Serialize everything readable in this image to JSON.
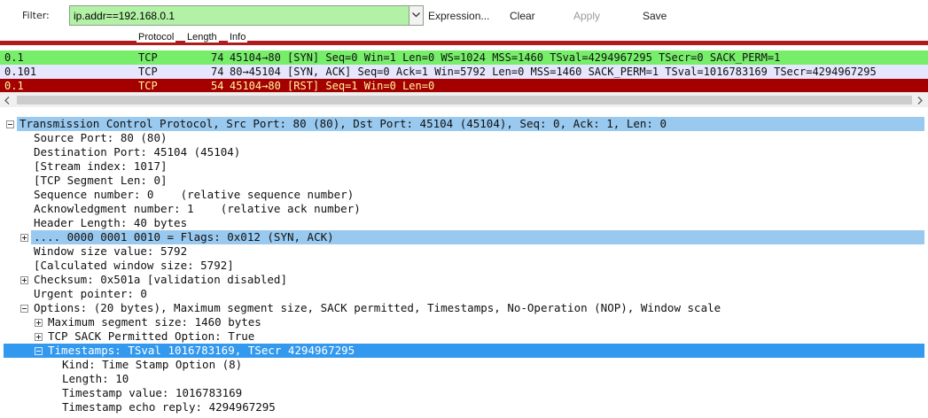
{
  "toolbar": {
    "filter_label": "Filter:",
    "filter_value": "ip.addr==192.168.0.1",
    "expression_label": "Expression...",
    "clear_label": "Clear",
    "apply_label": "Apply",
    "save_label": "Save"
  },
  "packet_list": {
    "columns": [
      "Protocol",
      "Length",
      "Info"
    ],
    "rows": [
      {
        "source": "0.1",
        "protocol": "TCP",
        "length": "74",
        "info": "45104→80 [SYN] Seq=0 Win=1 Len=0 WS=1024 MSS=1460 TSval=4294967295 TSecr=0 SACK_PERM=1",
        "bg": "#76ee6a",
        "fg": "#101010"
      },
      {
        "source": "0.101",
        "protocol": "TCP",
        "length": "74",
        "info": "80→45104 [SYN, ACK] Seq=0 Ack=1 Win=5792 Len=0 MSS=1460 SACK_PERM=1 TSval=1016783169 TSecr=4294967295",
        "bg": "#e7e6ff",
        "fg": "#101010"
      },
      {
        "source": "0.1",
        "protocol": "TCP",
        "length": "54",
        "info": "45104→80 [RST] Seq=1 Win=0 Len=0",
        "bg": "#a40000",
        "fg": "#fff7a0"
      }
    ]
  },
  "details": {
    "tcp_header": "Transmission Control Protocol, Src Port: 80 (80), Dst Port: 45104 (45104), Seq: 0, Ack: 1, Len: 0",
    "source_port": "Source Port: 80 (80)",
    "destination_port": "Destination Port: 45104 (45104)",
    "stream_index": "[Stream index: 1017]",
    "segment_len": "[TCP Segment Len: 0]",
    "sequence_number": "Sequence number: 0    (relative sequence number)",
    "ack_number": "Acknowledgment number: 1    (relative ack number)",
    "header_length": "Header Length: 40 bytes",
    "flags": ".... 0000 0001 0010 = Flags: 0x012 (SYN, ACK)",
    "window_size": "Window size value: 5792",
    "calc_window": "[Calculated window size: 5792]",
    "checksum": "Checksum: 0x501a [validation disabled]",
    "urgent_pointer": "Urgent pointer: 0",
    "options": "Options: (20 bytes), Maximum segment size, SACK permitted, Timestamps, No-Operation (NOP), Window scale",
    "mss": "Maximum segment size: 1460 bytes",
    "sack_permitted": "TCP SACK Permitted Option: True",
    "timestamps": "Timestamps: TSval 1016783169, TSecr 4294967295",
    "ts_kind": "Kind: Time Stamp Option (8)",
    "ts_length": "Length: 10",
    "ts_value": "Timestamp value: 1016783169",
    "ts_echo": "Timestamp echo reply: 4294967295"
  },
  "colors": {
    "filter_valid": "#b3f2a6",
    "syn_row": "#76ee6a",
    "rst_row": "#a40000",
    "highlight": "#99c9ef",
    "selected": "#3399ee"
  }
}
